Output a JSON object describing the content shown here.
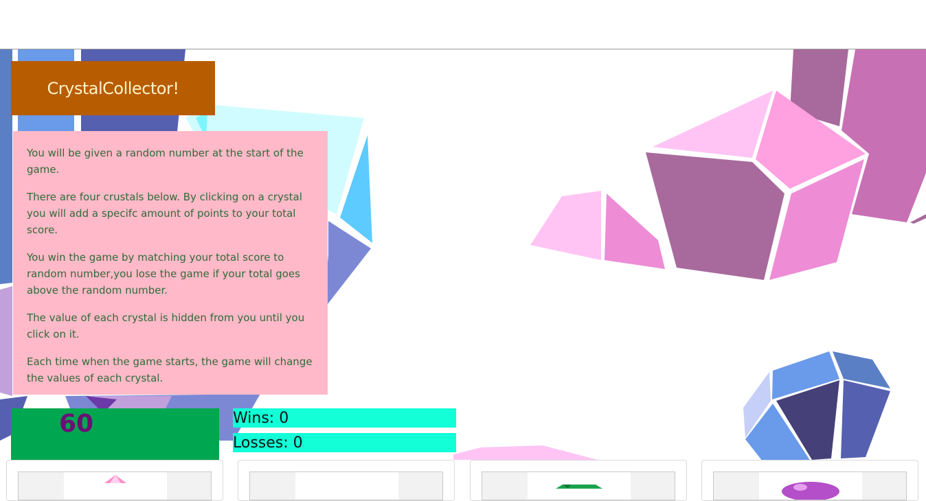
{
  "header": {
    "title": "CrystalCollector!"
  },
  "instructions": [
    "You will be given a random number at the start of the game.",
    "There are four crustals below. By clicking on a crystal you will add a specifc amount of points to your total score.",
    "You win the game by matching your total score to random number,you lose the game if your total goes above the random number.",
    "The value of each crystal is hidden from you until you click on it.",
    "Each time when the game starts, the game will change the values of each crystal."
  ],
  "game": {
    "random_number": "60",
    "wins_label": "Wins: 0",
    "losses_label": "Losses: 0"
  },
  "crystals": [
    {
      "name": "pink-crystal-icon",
      "color": "#ff8fc8"
    },
    {
      "name": "blank-crystal-icon",
      "color": "#ffffff"
    },
    {
      "name": "green-crystal-icon",
      "color": "#1aa34a"
    },
    {
      "name": "purple-crystal-icon",
      "color": "#b44ec9"
    }
  ],
  "colors": {
    "title_bg": "#b85c00",
    "title_text": "#fff3c8",
    "info_bg": "#ffb9c8",
    "info_text": "#2f6b3a",
    "score_bg": "#00a650",
    "score_text": "#6b0f75",
    "stat_bg": "#12ffd8"
  }
}
